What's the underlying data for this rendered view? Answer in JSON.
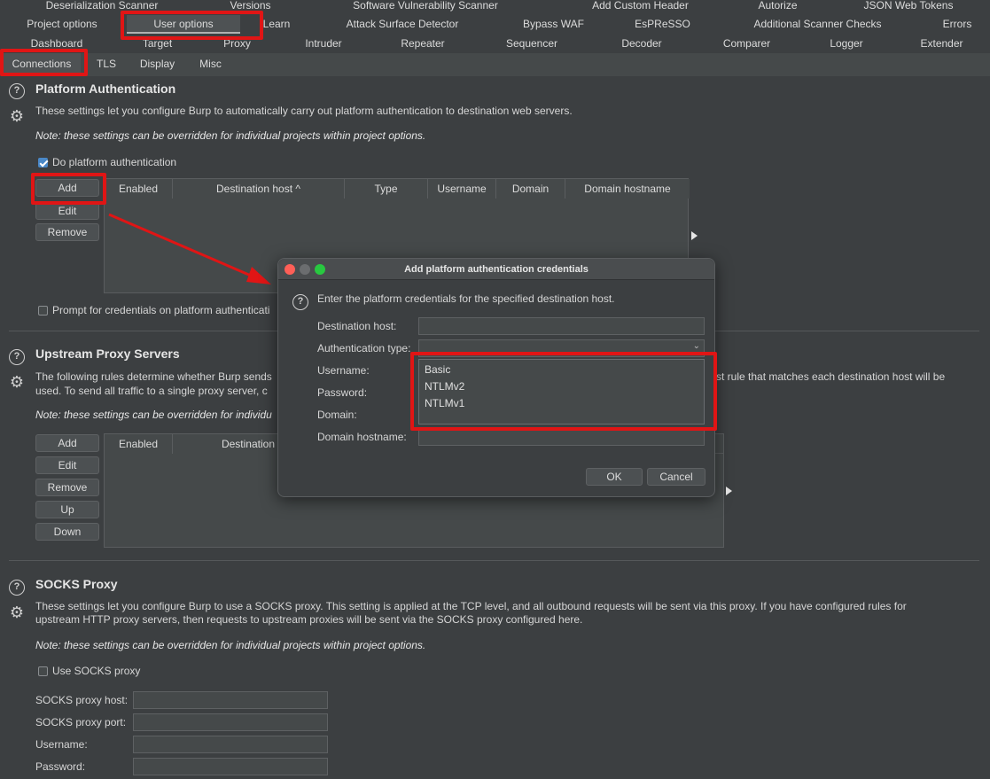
{
  "tabs_row1": [
    "Deserialization Scanner",
    "Versions",
    "Software Vulnerability Scanner",
    "Add Custom Header",
    "Autorize",
    "JSON Web Tokens"
  ],
  "tabs_row2": [
    "Project options",
    "User options",
    "Learn",
    "Attack Surface Detector",
    "Bypass WAF",
    "EsPReSSO",
    "Additional Scanner Checks",
    "Errors"
  ],
  "tabs_row3": [
    "Dashboard",
    "Target",
    "Proxy",
    "Intruder",
    "Repeater",
    "Sequencer",
    "Decoder",
    "Comparer",
    "Logger",
    "Extender"
  ],
  "subtabs": [
    "Connections",
    "TLS",
    "Display",
    "Misc"
  ],
  "platform_auth": {
    "title": "Platform Authentication",
    "desc": "These settings let you configure Burp to automatically carry out platform authentication to destination web servers.",
    "note": "Note: these settings can be overridden for individual projects within project options.",
    "checkbox_label": "Do platform authentication",
    "buttons": [
      "Add",
      "Edit",
      "Remove"
    ],
    "columns": [
      "Enabled",
      "Destination host ^",
      "Type",
      "Username",
      "Domain",
      "Domain hostname"
    ],
    "prompt_label": "Prompt for credentials on platform authenticati"
  },
  "upstream": {
    "title": "Upstream Proxy Servers",
    "desc_line1": "The following rules determine whether Burp sends",
    "desc_line1_tail": "st rule that matches each destination host will be",
    "desc_line2": "used. To send all traffic to a single proxy server, c",
    "note": "Note: these settings can be overridden for individu",
    "buttons": [
      "Add",
      "Edit",
      "Remove",
      "Up",
      "Down"
    ],
    "columns": [
      "Enabled",
      "Destination"
    ]
  },
  "socks": {
    "title": "SOCKS Proxy",
    "desc_line1": "These settings let you configure Burp to use a SOCKS proxy. This setting is applied at the TCP level, and all outbound requests will be sent via this proxy. If you have configured rules for",
    "desc_line2": "upstream HTTP proxy servers, then requests to upstream proxies will be sent via the SOCKS proxy configured here.",
    "note": "Note: these settings can be overridden for individual projects within project options.",
    "checkbox_label": "Use SOCKS proxy",
    "fields": [
      "SOCKS proxy host:",
      "SOCKS proxy port:",
      "Username:",
      "Password:"
    ]
  },
  "dialog": {
    "title": "Add platform authentication credentials",
    "prompt": "Enter the platform credentials for the specified destination host.",
    "labels": [
      "Destination host:",
      "Authentication type:",
      "Username:",
      "Password:",
      "Domain:",
      "Domain hostname:"
    ],
    "auth_options": [
      "Basic",
      "NTLMv2",
      "NTLMv1"
    ],
    "ok": "OK",
    "cancel": "Cancel"
  },
  "colors": {
    "background": "#3c3f41",
    "annotation_red": "#e01515",
    "checkbox_blue": "#4a88c7"
  }
}
